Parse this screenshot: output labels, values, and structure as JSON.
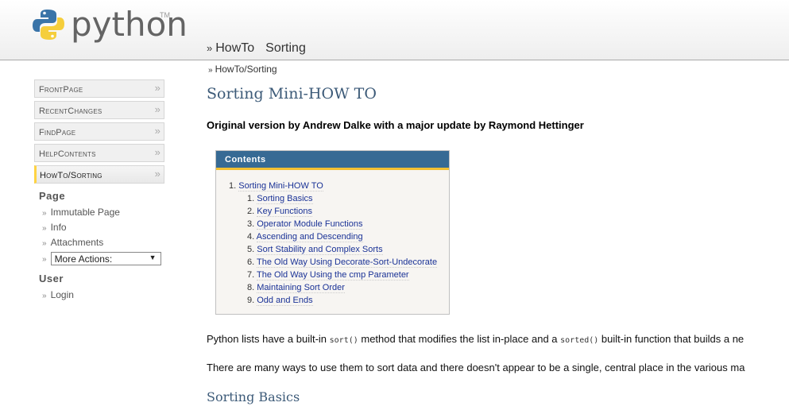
{
  "header": {
    "logo_text": "python",
    "trademark": "TM",
    "pagetrail": [
      {
        "raquo": "»",
        "label": "HowTo"
      },
      {
        "label": "Sorting"
      }
    ],
    "breadcrumb_raquo": "»",
    "breadcrumb": "HowTo/Sorting"
  },
  "sidebar": {
    "nav_items": [
      {
        "label": "FrontPage",
        "arrow": "»",
        "current": false
      },
      {
        "label": "RecentChanges",
        "arrow": "»",
        "current": false
      },
      {
        "label": "FindPage",
        "arrow": "»",
        "current": false
      },
      {
        "label": "HelpContents",
        "arrow": "»",
        "current": false
      },
      {
        "label": "HowTo/Sorting",
        "arrow": "»",
        "current": true
      }
    ],
    "page_heading": "Page",
    "page_links": [
      "Immutable Page",
      "Info",
      "Attachments"
    ],
    "more_actions": {
      "selected": "More Actions:",
      "indicator": "▼"
    },
    "user_heading": "User",
    "user_links": [
      "Login"
    ],
    "raquo": "»"
  },
  "content": {
    "title": "Sorting Mini-HOW TO",
    "byline": "Original version by Andrew Dalke with a major update by Raymond Hettinger",
    "toc": {
      "heading": "Contents",
      "top": {
        "num": "1.",
        "label": "Sorting Mini-HOW TO"
      },
      "items": [
        {
          "num": "1.",
          "label": "Sorting Basics"
        },
        {
          "num": "2.",
          "label": "Key Functions"
        },
        {
          "num": "3.",
          "label": "Operator Module Functions"
        },
        {
          "num": "4.",
          "label": "Ascending and Descending"
        },
        {
          "num": "5.",
          "label": "Sort Stability and Complex Sorts"
        },
        {
          "num": "6.",
          "label": "The Old Way Using Decorate-Sort-Undecorate"
        },
        {
          "num": "7.",
          "label": "The Old Way Using the cmp Parameter"
        },
        {
          "num": "8.",
          "label": "Maintaining Sort Order"
        },
        {
          "num": "9.",
          "label": "Odd and Ends"
        }
      ]
    },
    "para1": {
      "a": "Python lists have a built-in ",
      "code1": "sort()",
      "b": " method that modifies the list in-place and a ",
      "code2": "sorted()",
      "c": " built-in function that builds a ne"
    },
    "para2": "There are many ways to use them to sort data and there doesn't appear to be a single, central place in the various ma",
    "section_heading": "Sorting Basics"
  },
  "colors": {
    "toc_header_bg": "#376a94",
    "toc_header_underline": "#f2bf32",
    "link": "#1a3296",
    "heading": "#3c5a78",
    "current_nav_marker": "#ffd343"
  }
}
